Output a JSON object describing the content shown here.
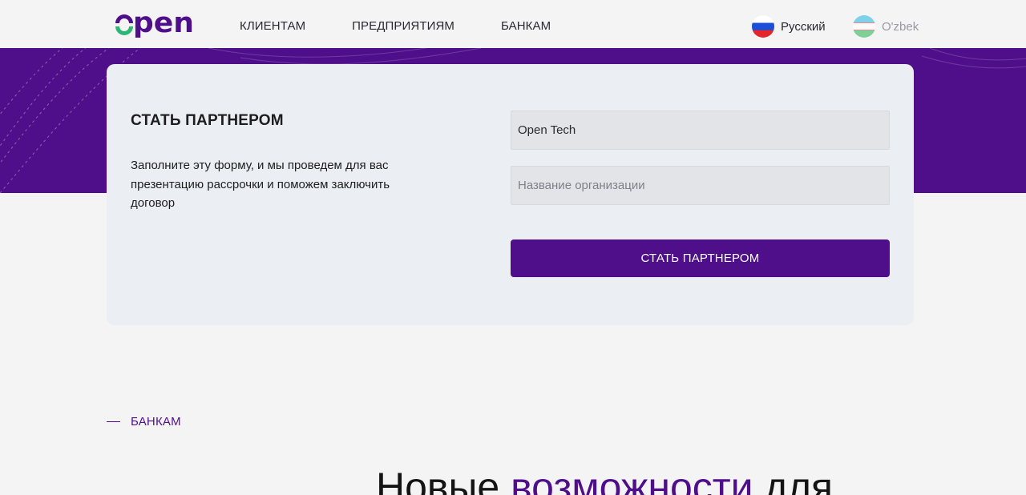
{
  "header": {
    "logo_text": "open",
    "nav": [
      "КЛИЕНТАМ",
      "ПРЕДПРИЯТИЯМ",
      "БАНКАМ"
    ],
    "languages": [
      {
        "label": "Русский",
        "icon": "russia-flag-icon",
        "active": true
      },
      {
        "label": "O'zbek",
        "icon": "uzbekistan-flag-icon",
        "active": false
      }
    ]
  },
  "form": {
    "title": "СТАТЬ ПАРТНЕРОМ",
    "description": "Заполните эту форму, и мы проведем для вас презентацию рассрочки и поможем заключить договор",
    "company_value": "Open Tech",
    "org_placeholder": "Название организации",
    "submit_label": "СТАТЬ ПАРТНЕРОМ"
  },
  "banks": {
    "tag": "БАНКАМ",
    "headline_part1": "Новые ",
    "headline_accent": "возможности",
    "headline_part2": " для"
  },
  "colors": {
    "brand_purple": "#4f0f8a",
    "logo_green": "#2bb673",
    "background": "#f4f4f5",
    "card": "#ebeef2"
  }
}
